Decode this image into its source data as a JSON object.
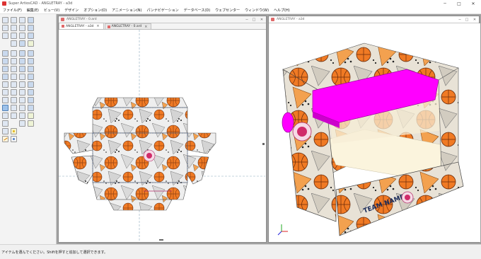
{
  "app": {
    "title": "Super ArtiosCAD - ANGLETRAY - a3d"
  },
  "menu": [
    "ファイル(F)",
    "編集(E)",
    "ビュー(V)",
    "デザイン",
    "オプション(O)",
    "アニメーション(N)",
    "パンナビゲーション",
    "データベース(D)",
    "ウェブセンター",
    "ウィンドウ(W)",
    "ヘルプ(H)"
  ],
  "window2d": {
    "title": "ANGLETRAY - 0.ard"
  },
  "window3d": {
    "title": "ANGLETRAY - a3d"
  },
  "tabs": [
    {
      "label": "ANGLETRAY - a3d",
      "close": "×"
    },
    {
      "label": "ANGLETRAY - 0.ard",
      "close": "×"
    }
  ],
  "box3d": {
    "team_text": "TEAM NAME",
    "side_text": "BASKETBALL",
    "handle_color": "#ff00ff",
    "floor_color": "#fbf4dd"
  },
  "status": {
    "text": "アイテムを選んでください。Shiftを押すと追加して選択できます。"
  },
  "colors": {
    "orange": "#f07a24",
    "magenta": "#ff00ff",
    "dieline": "#8da9bd"
  }
}
